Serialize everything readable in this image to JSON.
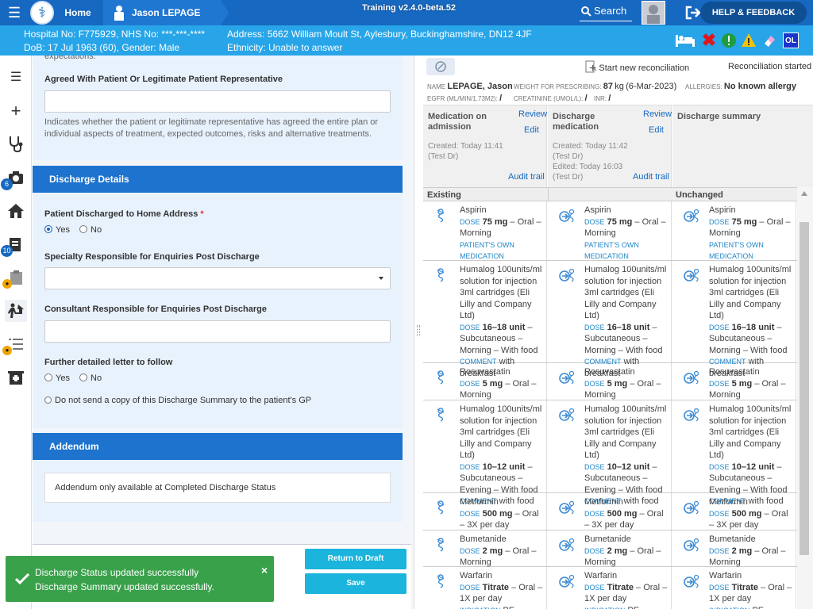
{
  "topbar": {
    "home": "Home",
    "patient_name": "Jason LEPAGE",
    "training": "Training v2.4.0-beta.52",
    "search": "Search",
    "help": "HELP & FEEDBACK"
  },
  "patient_bar": {
    "line1": "Hospital No: F775929, NHS No: ***-***-****",
    "line2": "DoB: 17 Jul 1963 (60), Gender: Male",
    "line3": "Address: 5662 William Moult St, Aylesbury, Buckinghamshire, DN12 4JF",
    "line4": "Ethnicity: Unable to answer",
    "ol_badge": "OL"
  },
  "sidebar": {
    "badge_camera": "6",
    "badge_notes": "10"
  },
  "form": {
    "cut_text": "expectations.",
    "agreed_label": "Agreed With Patient Or Legitimate Patient Representative",
    "agreed_help": "Indicates whether the patient or legitimate representative has agreed the entire plan or individual aspects of treatment, expected outcomes, risks and alternative treatments.",
    "discharge_header": "Discharge Details",
    "home_label": "Patient Discharged to Home Address",
    "required_mark": "*",
    "yes": "Yes",
    "no": "No",
    "specialty_label": "Specialty Responsible for Enquiries Post Discharge",
    "consultant_label": "Consultant Responsible for Enquiries Post Discharge",
    "letter_label": "Further detailed letter to follow",
    "gp_copy": "Do not send a copy of this Discharge Summary to the patient's GP",
    "addendum_header": "Addendum",
    "addendum_text": "Addendum only available at Completed Discharge Status",
    "btn_return": "Return to Draft",
    "btn_save": "Save"
  },
  "toast": {
    "line1": "Discharge Status updated successfully",
    "line2": "Discharge Summary updated successfully."
  },
  "recon": {
    "start": "Start new reconciliation",
    "started": "Reconciliation started",
    "name_label": "NAME",
    "name": "LEPAGE, Jason",
    "weight_label": "WEIGHT FOR PRESCRIBING:",
    "weight": "87",
    "weight_unit": "kg",
    "weight_date": "(6-Mar-2023)",
    "allergy_label": "ALLERGIES:",
    "allergy": "No known allergy",
    "egfr_label": "EGFR (ML/MIN/1.73M2):",
    "egfr": "/",
    "creat_label": "CREATININE (UMOL/L):",
    "creat": "/",
    "inr_label": "INR:",
    "inr": "/",
    "col1": {
      "title1": "Medication on",
      "title2": "admission",
      "review": "Review",
      "edit": "Edit",
      "created": "Created: Today 11:41",
      "by": "(Test Dr)",
      "audit": "Audit trail"
    },
    "col2": {
      "title1": "Discharge",
      "title2": "medication",
      "review": "Review",
      "edit": "Edit",
      "created": "Created: Today 11:42",
      "by": "(Test Dr)",
      "edited": "Edited: Today 16:03",
      "by2": "(Test Dr)",
      "audit": "Audit trail"
    },
    "col3": {
      "title": "Discharge summary"
    },
    "group_existing": "Existing",
    "group_unchanged": "Unchanged",
    "dose_key": "DOSE",
    "comment_key": "COMMENT",
    "indication_key": "INDICATION",
    "rows": [
      {
        "name": "Aspirin",
        "dose": "75 mg",
        "route": "Oral",
        "timing": "Morning",
        "extra": "PATIENT'S OWN MEDICATION"
      },
      {
        "name": "Humalog 100units/ml solution for injection 3ml cartridges (Eli Lilly and Company Ltd)",
        "dose": "16–18 unit",
        "route": "Subcutaneous",
        "timing": "Morning – With food",
        "comment": "with breakfast"
      },
      {
        "name": "Rosuvastatin",
        "dose": "5 mg",
        "route": "Oral",
        "timing": "Morning"
      },
      {
        "name": "Humalog 100units/ml solution for injection 3ml cartridges (Eli Lilly and Company Ltd)",
        "dose": "10–12 unit",
        "route": "Subcutaneous",
        "timing": "Evening – With food",
        "comment": "with food"
      },
      {
        "name": "Metformin",
        "dose": "500 mg",
        "route": "Oral",
        "timing": "3X per day"
      },
      {
        "name": "Bumetanide",
        "dose": "2 mg",
        "route": "Oral",
        "timing": "Morning"
      },
      {
        "name": "Warfarin",
        "dose": "Titrate",
        "route": "Oral",
        "timing": "1X per day",
        "indication": "PE"
      }
    ]
  },
  "colors": {
    "header": "#1668c0",
    "patient_bar": "#28a5e8",
    "section": "#1d73cd",
    "button": "#1ab4dc",
    "toast": "#3aa14b"
  }
}
